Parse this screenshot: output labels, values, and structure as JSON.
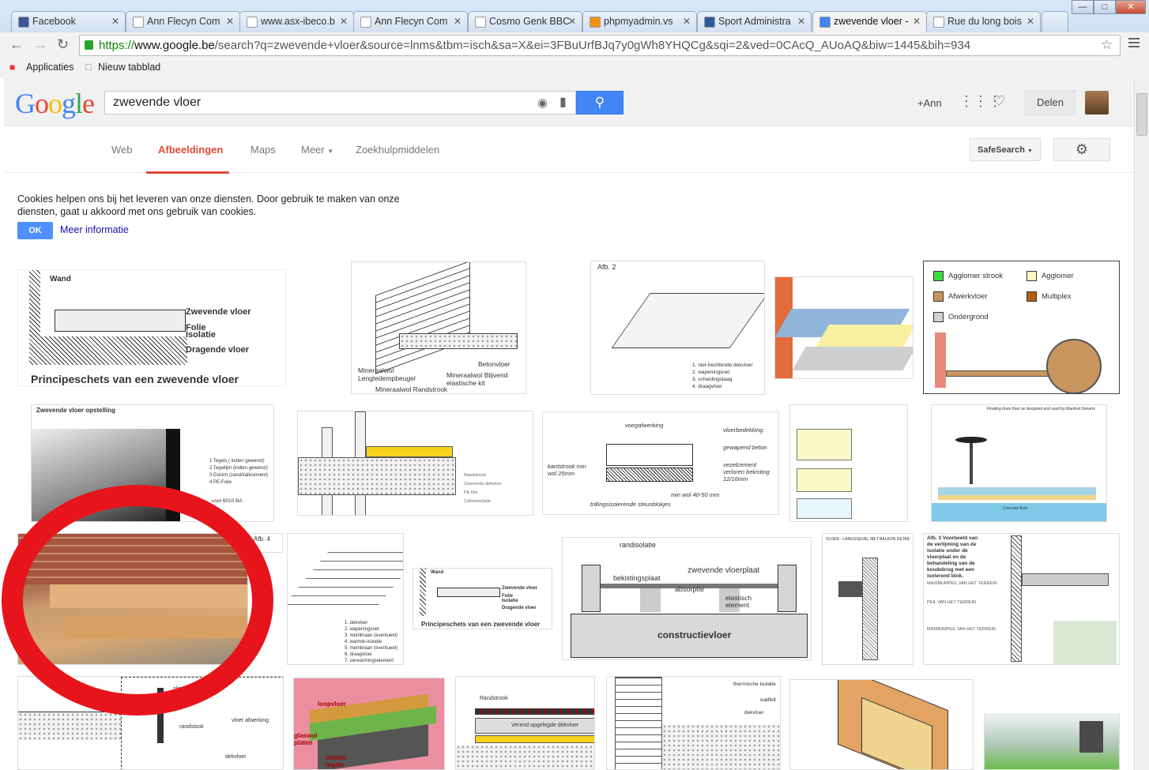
{
  "browser": {
    "tabs": [
      {
        "label": "Facebook",
        "fav": "#3b5998"
      },
      {
        "label": "Ann Flecyn Com",
        "fav": "#ffffff"
      },
      {
        "label": "www.asx-ibeco.b",
        "fav": "#ffffff"
      },
      {
        "label": "Ann Flecyn Com",
        "fav": "#ffffff"
      },
      {
        "label": "Cosmo Genk BBC",
        "fav": "#ffffff"
      },
      {
        "label": "phpmyadmin.vs",
        "fav": "#f29111"
      },
      {
        "label": "Sport Administra",
        "fav": "#2a5d9f"
      },
      {
        "label": "zwevende vloer -",
        "fav": "#4285f4"
      },
      {
        "label": "Rue du long bois",
        "fav": "#ffffff"
      }
    ],
    "url_scheme": "https://",
    "url_host": "www.google.be",
    "url_rest": "/search?q=zwevende+vloer&source=lnms&tbm=isch&sa=X&ei=3FBuUrfBJq7y0gWh8YHQCg&sqi=2&ved=0CAcQ_AUoAQ&biw=1445&bih=934",
    "bookmarks": {
      "apps": "Applicaties",
      "new_tab": "Nieuw tabblad"
    }
  },
  "google": {
    "logo": [
      "G",
      "o",
      "o",
      "g",
      "l",
      "e"
    ],
    "logo_colors": [
      "#4285f4",
      "#ea4335",
      "#fbbc05",
      "#4285f4",
      "#34a853",
      "#ea4335"
    ],
    "query": "zwevende vloer",
    "user": "+Ann",
    "share": "Delen"
  },
  "nav_tabs": [
    "Web",
    "Afbeeldingen",
    "Maps",
    "Meer",
    "Zoekhulpmiddelen"
  ],
  "safesearch": "SafeSearch",
  "cookies": {
    "text": "Cookies helpen ons bij het leveren van onze diensten. Door gebruik te maken van onze diensten, gaat u akkoord met ons gebruik van cookies.",
    "ok": "OK",
    "more": "Meer informatie"
  },
  "images": {
    "principe_1": {
      "wand": "Wand",
      "zwevende": "Zwevende vloer",
      "folie": "Folie",
      "isolatie": "Isolatie",
      "dragende": "Dragende vloer",
      "title": "Principeschets van een zwevende vloer"
    },
    "wall_labels": {
      "mineraalwol_lengte": "Mineraalwol Lengtedempbeugel",
      "betonvloer": "Betonvloer",
      "mineraalwol_kit": "Mineraalwol Blijvend elastische kit",
      "randstrook": "Mineraalwol Randstrook"
    },
    "afb2": {
      "title": "Afb. 2",
      "legend": [
        "1. niet-hechtende dekvloer",
        "2. wapeningsnet",
        "3. scheidingslaag",
        "4. draagvloer"
      ]
    },
    "agglomer": {
      "items": [
        "Agglomer strook",
        "Agglomer",
        "Afwerkvloer",
        "Multiplex",
        "Ondergrond"
      ],
      "colors": [
        "#3ddc3d",
        "#fff7c4",
        "#c8955f",
        "#b35c10",
        "#d0d0d0"
      ]
    },
    "opstelling": {
      "title": "Zwevende vloer opstelling",
      "items": [
        "1 Tegels ( indien gewenst)",
        "2 Tegellijm (indien gewenst)",
        "3 Estrich (zand/kalkcement)",
        "4 PE-Folie"
      ],
      "code": "usol 6010 BA"
    },
    "section2": {
      "items": [
        "Randstrook",
        "Zwevende dekvloer",
        "PE film",
        "Celluloisolatie"
      ]
    },
    "vloerbedekking": {
      "labels": [
        "voegafwerking",
        "vloerbedekking",
        "gewapend beton",
        "vezelcement verloren bekisting 12/16mm",
        "kantstrook min wol 25mm",
        "min wol 40-50 mm",
        "trillingsisolerende steunblokjes"
      ]
    },
    "drum": {
      "title": "Floating drum floor as designed and used by Manfred Dievers",
      "bottom": "Concrete floor"
    },
    "afb4": {
      "title": "Afb. 4",
      "legend": [
        "1. dekvloer",
        "2. wapeningsnet",
        "3. membraan (eventueel)",
        "4. warmte-isolatie",
        "5. membraan (eventueel)",
        "6. draagvloer",
        "7. verwarmingselement"
      ]
    },
    "principe_2": {
      "wand": "Wand",
      "zwevende": "Zwevende vloer",
      "folie": "Folie",
      "isolatie": "Isolatie",
      "dragende": "Dragende vloer",
      "title": "Principeschets van een zwevende vloer"
    },
    "constructie": {
      "labels": [
        "randisolatie",
        "zwevende vloerplaat",
        "bekistingsplaat",
        "absorptie",
        "elastisch element",
        "constructievloer"
      ]
    },
    "balkon": {
      "title": "VLOER - LANGSGEVEL MET BALKON DETAIL"
    },
    "afb3": {
      "title": "Afb. 3 Voorbeeld van de verlijming van de isolatie onder de vloerplaat en de behandeling van de koudebrug met een isolerend blok.",
      "levels": [
        "MAXIMUMPEIL VAN HET TERREIN",
        "PEIL VAN HET TERREIN",
        "MINIMUMPEIL VAN HET TERREIN"
      ]
    },
    "row4": {
      "plint": "plint",
      "randstook": "randstook",
      "vloer": "vloer afwerking",
      "dekvloer": "dekvloer",
      "loopvloer": "loopvloer",
      "glaswol": "glaswol platen",
      "trottoir": "trottoir tegels",
      "randstrook": "Randstrook",
      "verend": "Verend opgelegde dekvloer",
      "therm": "thermische isolatie",
      "wallfelt": "wallfelt",
      "dekvloer2": "dekvloer"
    }
  }
}
